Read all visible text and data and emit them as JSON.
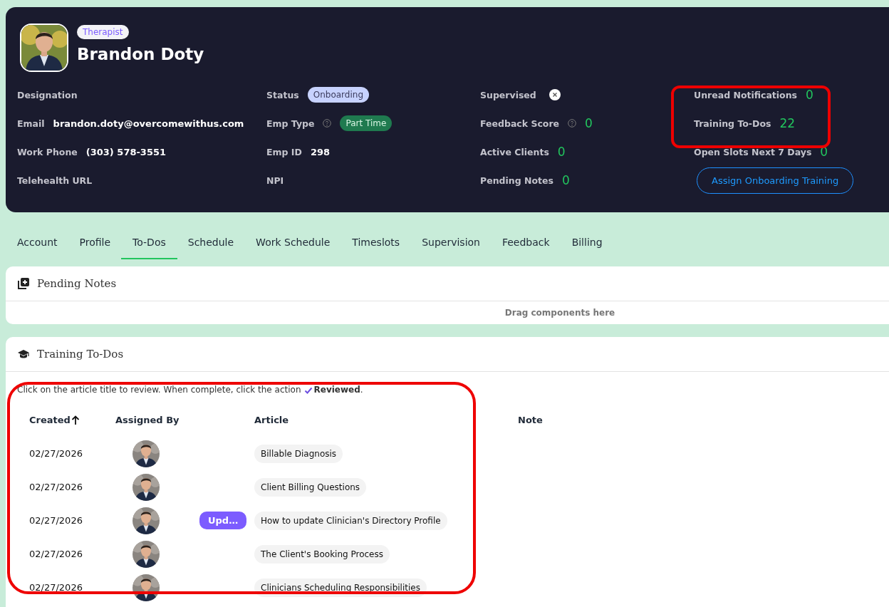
{
  "header": {
    "role": "Therapist",
    "name": "Brandon Doty",
    "columns": [
      {
        "fields": [
          {
            "label": "Designation",
            "kind": "text"
          },
          {
            "label": "Email",
            "kind": "text",
            "value": "brandon.doty@overcomewithus.com"
          },
          {
            "label": "Work Phone",
            "kind": "text",
            "value": "(303) 578-3551"
          },
          {
            "label": "Telehealth URL",
            "kind": "text"
          }
        ]
      },
      {
        "fields": [
          {
            "label": "Status",
            "kind": "badge",
            "value": "Onboarding",
            "color": "#c7d2fe"
          },
          {
            "label": "Emp Type",
            "kind": "badge",
            "value": "Part Time",
            "color": "#1f7a4f",
            "help": true
          },
          {
            "label": "Emp ID",
            "kind": "text",
            "value": "298"
          },
          {
            "label": "NPI",
            "kind": "text"
          }
        ]
      },
      {
        "fields": [
          {
            "label": "Supervised",
            "kind": "toggle",
            "on": false
          },
          {
            "label": "Feedback Score",
            "kind": "stat",
            "value": "0",
            "help": true
          },
          {
            "label": "Active Clients",
            "kind": "stat",
            "value": "0"
          },
          {
            "label": "Pending Notes",
            "kind": "stat",
            "value": "0"
          }
        ]
      },
      {
        "highlighted": true,
        "fields": [
          {
            "label": "Unread Notifications",
            "kind": "stat",
            "value": "0"
          },
          {
            "label": "Training To-Dos",
            "kind": "stat",
            "value": "22"
          },
          {
            "label": "Open Slots Next 7 Days",
            "kind": "stat",
            "value": "0"
          }
        ],
        "button": "Assign Onboarding Training"
      }
    ]
  },
  "tabs": [
    {
      "label": "Account",
      "selected": false
    },
    {
      "label": "Profile",
      "selected": false
    },
    {
      "label": "To-Dos",
      "selected": true
    },
    {
      "label": "Schedule",
      "selected": false
    },
    {
      "label": "Work Schedule",
      "selected": false
    },
    {
      "label": "Timeslots",
      "selected": false
    },
    {
      "label": "Supervision",
      "selected": false
    },
    {
      "label": "Feedback",
      "selected": false
    },
    {
      "label": "Billing",
      "selected": false
    }
  ],
  "pending_notes": {
    "title": "Pending Notes",
    "placeholder_text": "Drag components here"
  },
  "training": {
    "title": "Training To-Dos",
    "instruction": "Click on the article title to review. When complete, click the action",
    "instruction_action": "Reviewed",
    "instruction_end": ".",
    "table": {
      "highlighted": true,
      "columns": [
        "Created",
        "Assigned By",
        "Article",
        "Note"
      ],
      "rows": [
        {
          "created": "02/27/2026",
          "article": "Billable Diagnosis"
        },
        {
          "created": "02/27/2026",
          "article": "Client Billing Questions"
        },
        {
          "created": "02/27/2026",
          "tag": "Upd…",
          "article": "How to update Clinician's Directory Profile"
        },
        {
          "created": "02/27/2026",
          "article": "The Client's Booking Process"
        },
        {
          "created": "02/27/2026",
          "article": "Clinicians Scheduling Responsibilities"
        }
      ]
    }
  }
}
